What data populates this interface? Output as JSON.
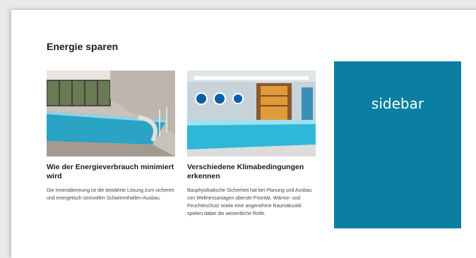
{
  "section": {
    "title": "Energie sparen"
  },
  "articles": [
    {
      "image": "pool-interior-glass-wall",
      "heading": "Wie der Energieverbrauch minimiert wird",
      "text": "Die Innendämmung ist die bewährte Lösung zum sicheren und energetisch sinnvollen Schwimmhallen-Ausbau."
    },
    {
      "image": "pool-with-portholes-sauna",
      "heading": "Verschiedene Klimabedingungen erkennen",
      "text": "Bauphysikalische Sicherheit hat bei Planung und Ausbau von Wellnessanlagen oberste Priorität. Wärme- und Feuchteschutz sowie eine angenehme Raumakustik spielen dabei die wesentliche Rolle."
    }
  ],
  "sidebar": {
    "label": "sidebar",
    "color": "#0a7fa1"
  }
}
